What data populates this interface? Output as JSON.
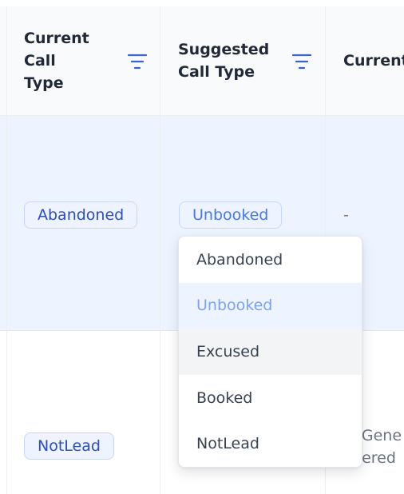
{
  "table": {
    "columns": [
      {
        "title": "Current\nCall\nType",
        "has_filter": true
      },
      {
        "title": "Suggested\nCall Type",
        "has_filter": true
      },
      {
        "title": "Current",
        "has_filter": false
      }
    ],
    "rows": [
      {
        "current_call_type": "Abandoned",
        "suggested_call_type": "Unbooked",
        "current": "-"
      },
      {
        "current_call_type": "NotLead",
        "current": "- Gene\nffered"
      }
    ]
  },
  "dropdown": {
    "options": [
      "Abandoned",
      "Unbooked",
      "Excused",
      "Booked",
      "NotLead"
    ],
    "selected": "Unbooked",
    "hovered": "Excused"
  },
  "colors": {
    "accent": "#3b63c9",
    "badge_text": "#2b4fb8",
    "row_highlight": "#eef4ff",
    "selected_option_text": "#7ea2ea"
  },
  "icons": {
    "filter": "filter-icon"
  }
}
